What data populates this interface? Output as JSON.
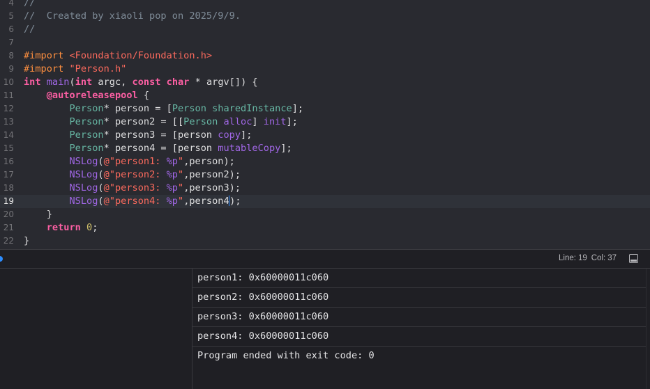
{
  "editor": {
    "lines": [
      {
        "num": "4",
        "segments": [
          {
            "t": "//",
            "c": "comment"
          }
        ]
      },
      {
        "num": "5",
        "segments": [
          {
            "t": "//  Created by xiaoli pop on 2025/9/9.",
            "c": "comment"
          }
        ]
      },
      {
        "num": "6",
        "segments": [
          {
            "t": "//",
            "c": "comment"
          }
        ]
      },
      {
        "num": "7",
        "segments": []
      },
      {
        "num": "8",
        "segments": [
          {
            "t": "#import ",
            "c": "pre"
          },
          {
            "t": "<Foundation/Foundation.h>",
            "c": "str"
          }
        ]
      },
      {
        "num": "9",
        "segments": [
          {
            "t": "#import ",
            "c": "pre"
          },
          {
            "t": "\"Person.h\"",
            "c": "str"
          }
        ]
      },
      {
        "num": "10",
        "segments": [
          {
            "t": "int",
            "c": "kw"
          },
          {
            "t": " "
          },
          {
            "t": "main",
            "c": "fn"
          },
          {
            "t": "("
          },
          {
            "t": "int",
            "c": "kw"
          },
          {
            "t": " argc, "
          },
          {
            "t": "const",
            "c": "kw"
          },
          {
            "t": " "
          },
          {
            "t": "char",
            "c": "kw"
          },
          {
            "t": " * argv[]) {"
          }
        ]
      },
      {
        "num": "11",
        "segments": [
          {
            "t": "    "
          },
          {
            "t": "@autoreleasepool",
            "c": "kw"
          },
          {
            "t": " {"
          }
        ]
      },
      {
        "num": "12",
        "segments": [
          {
            "t": "        "
          },
          {
            "t": "Person",
            "c": "cls2"
          },
          {
            "t": "* person = ["
          },
          {
            "t": "Person",
            "c": "cls2"
          },
          {
            "t": " "
          },
          {
            "t": "sharedInstance",
            "c": "cls2"
          },
          {
            "t": "];"
          }
        ]
      },
      {
        "num": "13",
        "segments": [
          {
            "t": "        "
          },
          {
            "t": "Person",
            "c": "cls2"
          },
          {
            "t": "* person2 = [["
          },
          {
            "t": "Person",
            "c": "cls2"
          },
          {
            "t": " "
          },
          {
            "t": "alloc",
            "c": "meth"
          },
          {
            "t": "] "
          },
          {
            "t": "init",
            "c": "meth"
          },
          {
            "t": "];"
          }
        ]
      },
      {
        "num": "14",
        "segments": [
          {
            "t": "        "
          },
          {
            "t": "Person",
            "c": "cls2"
          },
          {
            "t": "* person3 = [person "
          },
          {
            "t": "copy",
            "c": "meth"
          },
          {
            "t": "];"
          }
        ]
      },
      {
        "num": "15",
        "segments": [
          {
            "t": "        "
          },
          {
            "t": "Person",
            "c": "cls2"
          },
          {
            "t": "* person4 = [person "
          },
          {
            "t": "mutableCopy",
            "c": "meth"
          },
          {
            "t": "];"
          }
        ]
      },
      {
        "num": "16",
        "segments": [
          {
            "t": "        "
          },
          {
            "t": "NSLog",
            "c": "meth"
          },
          {
            "t": "("
          },
          {
            "t": "@\"person1: ",
            "c": "str"
          },
          {
            "t": "%p",
            "c": "meth"
          },
          {
            "t": "\"",
            "c": "str"
          },
          {
            "t": ",person);"
          }
        ]
      },
      {
        "num": "17",
        "segments": [
          {
            "t": "        "
          },
          {
            "t": "NSLog",
            "c": "meth"
          },
          {
            "t": "("
          },
          {
            "t": "@\"person2: ",
            "c": "str"
          },
          {
            "t": "%p",
            "c": "meth"
          },
          {
            "t": "\"",
            "c": "str"
          },
          {
            "t": ",person2);"
          }
        ]
      },
      {
        "num": "18",
        "segments": [
          {
            "t": "        "
          },
          {
            "t": "NSLog",
            "c": "meth"
          },
          {
            "t": "("
          },
          {
            "t": "@\"person3: ",
            "c": "str"
          },
          {
            "t": "%p",
            "c": "meth"
          },
          {
            "t": "\"",
            "c": "str"
          },
          {
            "t": ",person3);"
          }
        ]
      },
      {
        "num": "19",
        "current": true,
        "segments": [
          {
            "t": "        "
          },
          {
            "t": "NSLog",
            "c": "meth"
          },
          {
            "t": "("
          },
          {
            "t": "@\"person4: ",
            "c": "str"
          },
          {
            "t": "%p",
            "c": "meth"
          },
          {
            "t": "\"",
            "c": "str"
          },
          {
            "t": ",person4"
          },
          {
            "t": "",
            "caret": true
          },
          {
            "t": ");"
          }
        ]
      },
      {
        "num": "20",
        "segments": [
          {
            "t": "    }"
          }
        ]
      },
      {
        "num": "21",
        "segments": [
          {
            "t": "    "
          },
          {
            "t": "return",
            "c": "kw"
          },
          {
            "t": " "
          },
          {
            "t": "0",
            "c": "num"
          },
          {
            "t": ";"
          }
        ]
      },
      {
        "num": "22",
        "segments": [
          {
            "t": "}"
          }
        ]
      }
    ]
  },
  "statusbar": {
    "line_label": "Line:",
    "line_value": "19",
    "col_label": "Col:",
    "col_value": "37"
  },
  "console": {
    "lines": [
      "person1: 0x60000011c060",
      "person2: 0x60000011c060",
      "person3: 0x60000011c060",
      "person4: 0x60000011c060",
      "Program ended with exit code: 0"
    ]
  },
  "colors": {
    "editor_bg": "#292a30",
    "current_line_bg": "#2f3239",
    "debug_bg": "#1f1f24",
    "accent": "#2d8dff"
  },
  "icons": {
    "breakpoint_indicator": "blue-dot",
    "panel_toggle": "bottom-panel-icon"
  }
}
